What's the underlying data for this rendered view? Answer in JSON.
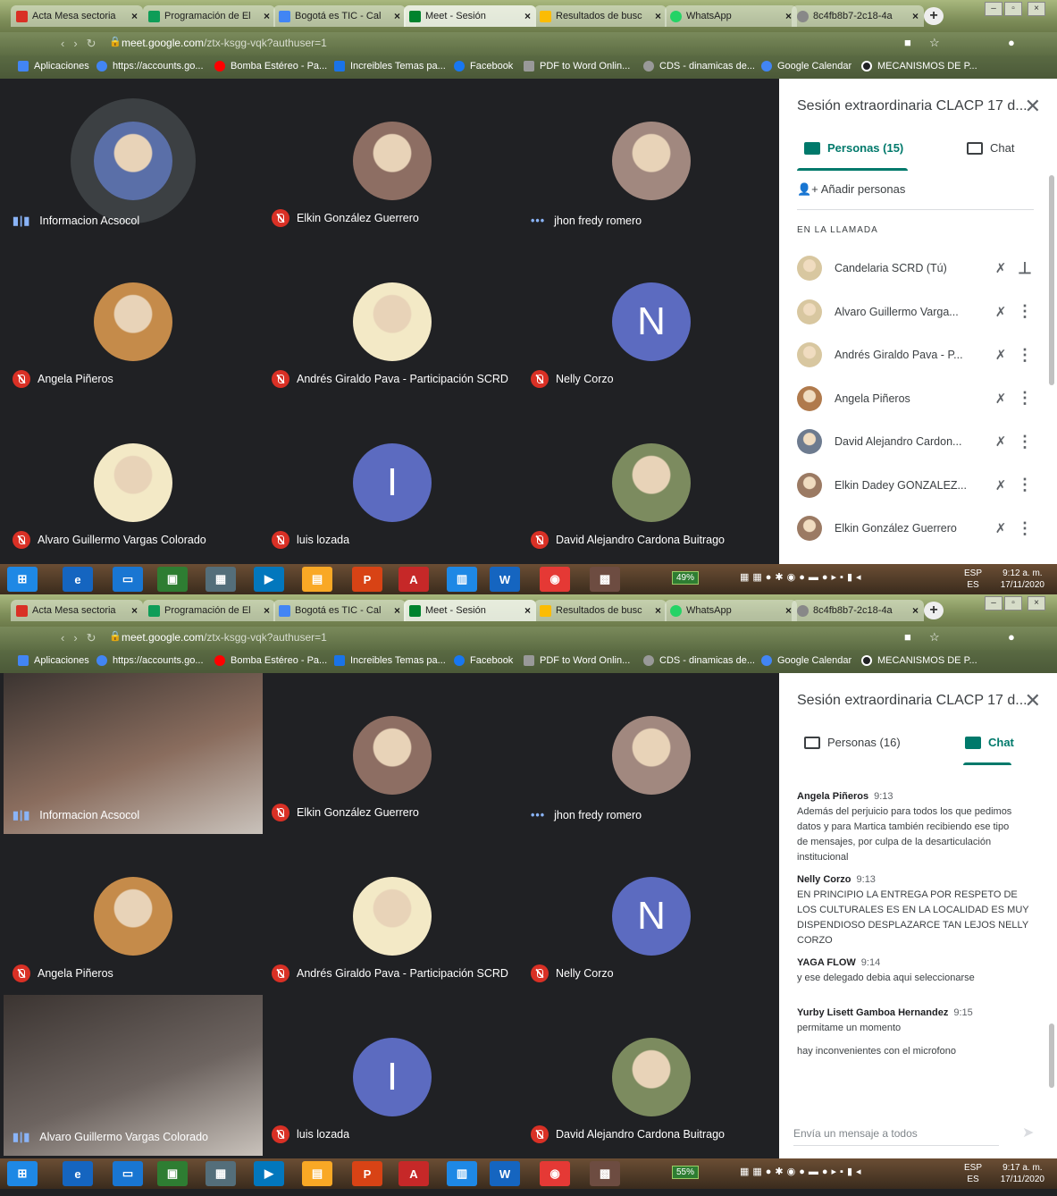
{
  "browser": {
    "tabs": [
      {
        "label": "Acta Mesa sectoria",
        "color": "#d93025"
      },
      {
        "label": "Programación de El",
        "color": "#0f9d58"
      },
      {
        "label": "Bogotá es TIC - Cal",
        "color": "#4285f4"
      },
      {
        "label": "Meet - Sesión",
        "color": "#00832d"
      },
      {
        "label": "Resultados de busc",
        "color": "#fbbc04"
      },
      {
        "label": "WhatsApp",
        "color": "#25d366"
      },
      {
        "label": "8c4fb8b7-2c18-4a",
        "color": "#888888"
      }
    ],
    "url_host": "meet.google.com",
    "url_path": "/ztx-ksgg-vqk?authuser=1",
    "bookmarks": [
      {
        "label": "Aplicaciones",
        "color": "#4285f4"
      },
      {
        "label": "https://accounts.go...",
        "color": "#4285f4"
      },
      {
        "label": "Bomba Estéreo - Pa...",
        "color": "#ff0000"
      },
      {
        "label": "Increibles Temas pa...",
        "color": "#1a73e8"
      },
      {
        "label": "Facebook",
        "color": "#1877f2"
      },
      {
        "label": "PDF to Word Onlin...",
        "color": "#999999"
      },
      {
        "label": "CDS - dinamicas de...",
        "color": "#999999"
      },
      {
        "label": "Google Calendar",
        "color": "#4285f4"
      },
      {
        "label": "MECANISMOS DE P...",
        "color": "#202124"
      }
    ]
  },
  "shot1": {
    "tiles": [
      {
        "name": "Informacion Acsocol",
        "status": "speaking",
        "avatar": "#5a6fa8"
      },
      {
        "name": "Elkin González Guerrero",
        "status": "muted",
        "avatar": "#8d6e63"
      },
      {
        "name": "jhon fredy romero",
        "status": "dots",
        "avatar": "#a1887f"
      },
      {
        "name": "Angela Piñeros",
        "status": "muted",
        "avatar": "#c58b4a"
      },
      {
        "name": "Andrés Giraldo Pava - Participación SCRD",
        "status": "muted",
        "avatar": "#f3e9c6"
      },
      {
        "name": "Nelly Corzo",
        "status": "muted",
        "letter": "N"
      },
      {
        "name": "Alvaro Guillermo Vargas Colorado",
        "status": "muted",
        "avatar": "#f3e9c6"
      },
      {
        "name": "luis lozada",
        "status": "muted",
        "letter": "I"
      },
      {
        "name": "David Alejandro Cardona Buitrago",
        "status": "muted",
        "avatar": "#7c8b5f"
      }
    ],
    "panel": {
      "title": "Sesión extraordinaria CLACP 17 d...",
      "people_tab": "Personas (15)",
      "chat_tab": "Chat",
      "add_people": "Añadir personas",
      "section": "EN LA LLAMADA",
      "people": [
        {
          "name": "Candelaria SCRD (Tú)",
          "avatar": "#d8c7a0",
          "action": "pin"
        },
        {
          "name": "Alvaro Guillermo Varga...",
          "avatar": "#d8c7a0",
          "action": "more"
        },
        {
          "name": "Andrés Giraldo Pava - P...",
          "avatar": "#d8c7a0",
          "action": "more"
        },
        {
          "name": "Angela Piñeros",
          "avatar": "#b07a4c",
          "action": "more"
        },
        {
          "name": "David Alejandro Cardon...",
          "avatar": "#6d7b8f",
          "action": "more"
        },
        {
          "name": "Elkin Dadey GONZALEZ...",
          "avatar": "#9b7a63",
          "action": "more"
        },
        {
          "name": "Elkin González Guerrero",
          "avatar": "#9b7a63",
          "action": "more"
        }
      ]
    },
    "battery": "49%",
    "time": "9:12 a. m.",
    "date": "17/11/2020"
  },
  "shot2": {
    "tiles": [
      {
        "name": "Informacion Acsocol",
        "status": "speaking",
        "video": "#8a6d5e"
      },
      {
        "name": "Elkin González Guerrero",
        "status": "muted",
        "avatar": "#8d6e63"
      },
      {
        "name": "jhon fredy romero",
        "status": "dots",
        "avatar": "#a1887f"
      },
      {
        "name": "Angela Piñeros",
        "status": "muted",
        "avatar": "#c58b4a"
      },
      {
        "name": "Andrés Giraldo Pava - Participación SCRD",
        "status": "muted",
        "avatar": "#f3e9c6"
      },
      {
        "name": "Nelly Corzo",
        "status": "muted",
        "letter": "N"
      },
      {
        "name": "Alvaro Guillermo Vargas Colorado",
        "status": "speaking",
        "video": "#6d6460"
      },
      {
        "name": "luis lozada",
        "status": "muted",
        "letter": "I"
      },
      {
        "name": "David Alejandro Cardona Buitrago",
        "status": "muted",
        "avatar": "#7c8b5f"
      }
    ],
    "panel": {
      "title": "Sesión extraordinaria CLACP 17 d...",
      "people_tab": "Personas (16)",
      "chat_tab": "Chat",
      "messages": [
        {
          "who": "Angela Piñeros",
          "time": "9:13",
          "lines": [
            "Además del perjuicio para todos los que pedimos",
            "datos y para Martica también recibiendo ese tipo",
            "de mensajes, por culpa de la desarticulación",
            "institucional"
          ]
        },
        {
          "who": "Nelly Corzo",
          "time": "9:13",
          "lines": [
            "EN PRINCIPIO  LA ENTREGA  POR RESPETO DE",
            "LOS CULTURALES  ES EN LA LOCALIDAD  ES  MUY",
            "DISPENDIOSO DESPLAZARCE TAN LEJOS NELLY",
            "CORZO"
          ]
        },
        {
          "who": "YAGA FLOW",
          "time": "9:14",
          "lines": [
            "y ese delegado debia aqui seleccionarse"
          ]
        },
        {
          "who": "Yurby Lisett Gamboa Hernandez",
          "time": "9:15",
          "lines": [
            "permitame un momento",
            "",
            "hay inconvenientes con el microfono"
          ]
        }
      ],
      "composer_placeholder": "Envía un mensaje a todos"
    },
    "battery": "55%",
    "time": "9:17 a. m.",
    "date": "17/11/2020"
  },
  "taskbar": {
    "lang_top": "ESP",
    "lang_bottom": "ES"
  }
}
